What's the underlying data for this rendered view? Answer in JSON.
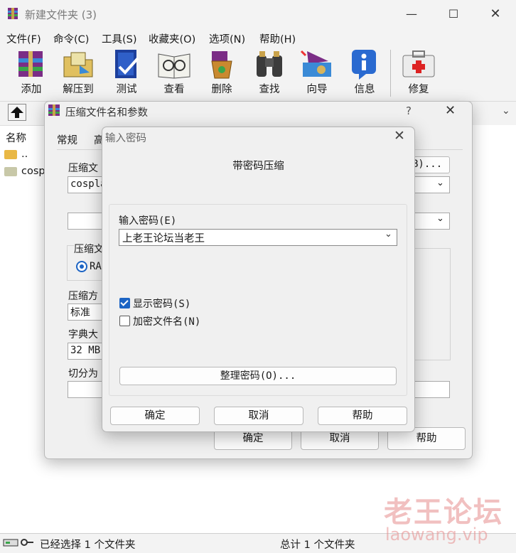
{
  "window": {
    "title": "新建文件夹 (3)"
  },
  "menu": [
    "文件(F)",
    "命令(C)",
    "工具(S)",
    "收藏夹(O)",
    "选项(N)",
    "帮助(H)"
  ],
  "toolbar": [
    "添加",
    "解压到",
    "测试",
    "查看",
    "删除",
    "查找",
    "向导",
    "信息",
    "修复"
  ],
  "file_list": {
    "column_name": "名称",
    "rows": [
      "..",
      "cosp"
    ]
  },
  "status": {
    "left": "已经选择 1 个文件夹",
    "right": "总计 1 个文件夹"
  },
  "watermark": {
    "line1": "老王论坛",
    "line2": "laowang.vip"
  },
  "archive_dialog": {
    "title": "压缩文件名和参数",
    "help_glyph": "?",
    "tabs": [
      "常规",
      "高"
    ],
    "archive_name_label": "压缩文",
    "archive_name_value": "cospla",
    "browse_button_fragment": "B)...",
    "format_label": "压缩文",
    "format_option": "RA",
    "method_label": "压缩方",
    "method_value": "标准",
    "dict_label": "字典大",
    "dict_value": "32 MB",
    "split_label": "切分为",
    "buttons": {
      "ok": "确定",
      "cancel": "取消",
      "help": "帮助"
    }
  },
  "password_dialog": {
    "title": "输入密码",
    "heading": "带密码压缩",
    "password_label": "输入密码(E)",
    "password_value": "上老王论坛当老王",
    "show_password": {
      "label": "显示密码(S)",
      "checked": true
    },
    "encrypt_names": {
      "label": "加密文件名(N)",
      "checked": false
    },
    "organize_button": "整理密码(O)...",
    "buttons": {
      "ok": "确定",
      "cancel": "取消",
      "help": "帮助"
    }
  },
  "colors": {
    "accent": "#1c64c4",
    "watermark": "#e68c8c"
  }
}
